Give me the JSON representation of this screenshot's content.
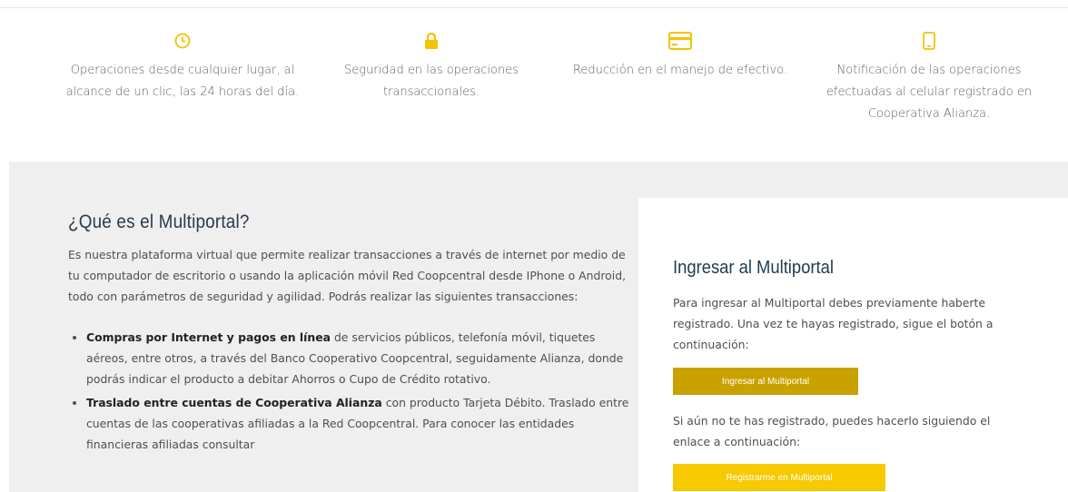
{
  "colors": {
    "accent": "#f3c300",
    "button_primary": "#c9a200",
    "button_secondary": "#f7c900",
    "panel_bg": "#efefef"
  },
  "features": [
    {
      "icon": "clock-icon",
      "text": "Operaciones desde cualquier lugar, al alcance de un clic, las 24 horas del día."
    },
    {
      "icon": "lock-icon",
      "text": "Seguridad en las operaciones transaccionales."
    },
    {
      "icon": "credit-card-icon",
      "text": "Reducción en el manejo de efectivo."
    },
    {
      "icon": "mobile-phone-icon",
      "text": "Notificación de las operaciones efectuadas al celular registrado en Cooperativa Alianza."
    }
  ],
  "info": {
    "title": "¿Qué es el Multiportal?",
    "intro": "Es nuestra plataforma virtual que permite realizar transacciones a través de internet por medio de tu computador de escritorio o usando la aplicación móvil Red Coopcentral desde IPhone o Android, todo con parámetros de seguridad y agilidad. Podrás realizar las siguientes transacciones:",
    "items": [
      {
        "bold": "Compras por Internet y pagos en línea",
        "text": " de servicios públicos, telefonía móvil, tiquetes aéreos, entre otros, a través del Banco Cooperativo Coopcentral, seguidamente Alianza, donde podrás indicar el producto a debitar Ahorros o Cupo de Crédito rotativo."
      },
      {
        "bold": "Traslado entre cuentas de Cooperativa Alianza",
        "text": " con producto Tarjeta Débito. Traslado entre cuentas de las cooperativas afiliadas a la Red Coopcentral. Para conocer las entidades financieras afiliadas consultar"
      }
    ]
  },
  "login_card": {
    "title": "Ingresar al Multiportal",
    "description": "Para ingresar al Multiportal debes previamente haberte registrado. Una vez te hayas registrado, sigue el botón a continuación:",
    "login_button": "Ingresar al Multiportal",
    "register_text": "Si aún no te has registrado, puedes hacerlo siguiendo el enlace a continuación:",
    "register_button": "Registrarme en Multiportal"
  }
}
